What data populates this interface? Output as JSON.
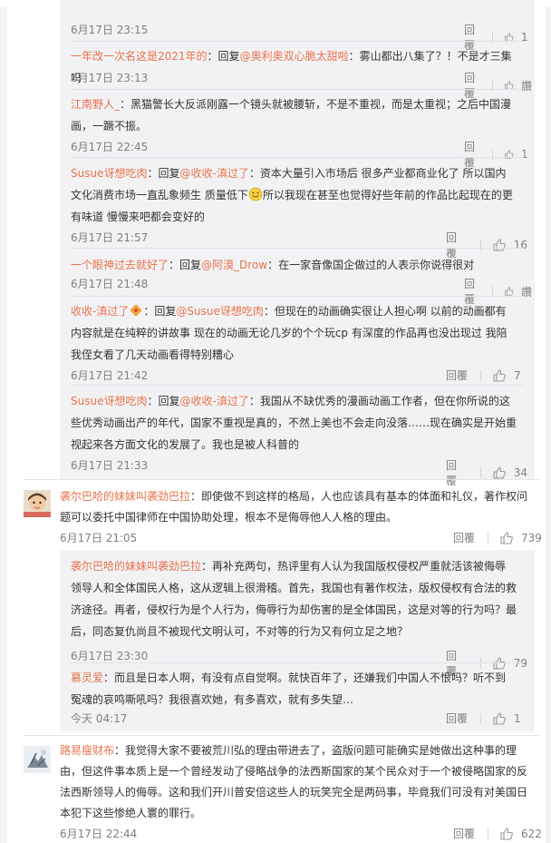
{
  "reply_label": "回覆",
  "replies_top": [
    {
      "time": "6月17日 23:15",
      "likes": "1"
    },
    {
      "user": "一年改一次名这是2021年的",
      "sep": "：回复",
      "mention": "@奥利奥双心脆太甜啦",
      "text": "：雾山都出八集了？！不是才三集吗",
      "time": "6月17日 23:13",
      "likes": "讚"
    },
    {
      "user": "江南野人_",
      "text": "：黑猫警长大反派刚露一个镜头就被腰斩，不是不重视，而是太重视；之后中国漫画，一蹶不振。",
      "time": "6月17日 22:45",
      "likes": "1"
    },
    {
      "user": "Susue讶想吃肉",
      "sep": "：回复",
      "mention": "@收收-滇过了",
      "text_a": "：资本大量引入市场后 很多产业都商业化了 所以国内文化消费市场一直乱象频生 质量低下",
      "text_b": "所以我现在甚至也觉得好些年前的作品比起现在的更有味道 慢慢来吧都会变好的",
      "time": "6月17日 21:57",
      "likes": "16"
    },
    {
      "user": "一个眼神过去就好了",
      "sep": "：回复",
      "mention": "@阿漠_Drow",
      "text": "：在一家音像国企做过的人表示你说得很对",
      "time": "6月17日 21:48",
      "likes": "讚"
    },
    {
      "user": "收收-滇过了",
      "sep": "：回复",
      "mention": "@Susue讶想吃肉",
      "text": "：但现在的动画确实很让人担心啊 以前的动画都有内容就是在纯粹的讲故事 现在的动画无论几岁的个个玩cp 有深度的作品再也没出现过 我陪我侄女看了几天动画看得特别糟心",
      "time": "6月17日 21:42",
      "likes": "7"
    },
    {
      "user": "Susue讶想吃肉",
      "sep": "：回复",
      "mention": "@收收-滇过了",
      "text": "：我国从不缺优秀的漫画动画工作者，但在你所说的这些优秀动画出产的年代，国家不重视是真的，不然上美也不会走向没落……现在确实是开始重视起来各方面文化的发展了。我也是被人科普的",
      "time": "6月17日 21:33",
      "likes": "34"
    }
  ],
  "comment2": {
    "user": "袭尔巴哈的妹妹叫袭劲巴拉",
    "text": "：即使做不到这样的格局，人也应该具有基本的体面和礼仪，著作权问题可以委托中国律师在中国协助处理，根本不是侮辱他人人格的理由。",
    "time": "6月17日 21:05",
    "likes": "739",
    "replies": [
      {
        "user": "袭尔巴哈的妹妹叫袭劲巴拉",
        "text": "：再补充两句，热评里有人认为我国版权侵权严重就活该被侮辱领导人和全体国民人格，这从逻辑上很滑稽。首先，我国也有著作权法，版权侵权有合法的救济途径。再者，侵权行为是个人行为，侮辱行为却伤害的是全体国民，这是对等的行为吗？最后，同态复仇尚且不被现代文明认可，不对等的行为又有何立足之地？",
        "time": "6月17日 23:30",
        "likes": "79"
      },
      {
        "user": "慕灵爱",
        "text": "：而且是日本人啊，有没有点自觉啊。就快百年了，还嫌我们中国人不恨吗？听不到冤魂的哀鸣嘶吼吗？我很喜欢她，有多喜欢，就有多失望…",
        "time": "今天 04:17",
        "likes": "1"
      }
    ]
  },
  "comment3": {
    "user": "路易瘦财布",
    "text": "：我觉得大家不要被荒川弘的理由带进去了，盗版问题可能确实是她做出这种事的理由，但这件事本质上是一个曾经发动了侵略战争的法西斯国家的某个民众对于一个被侵略国家的反法西斯领导人的侮辱。这和我们开川普安倍这些人的玩笑完全是两码事，毕竟我们可没有对美国日本犯下这些惨绝人寰的罪行。",
    "time": "6月17日 22:44",
    "likes": "622"
  },
  "colors": {
    "username": "#e8734b",
    "meta": "#808080",
    "reply_bg": "#f2f2f5"
  },
  "icons": {
    "like": "thumbs-up-icon",
    "search": "search-icon",
    "emoji": "smile-emoji-icon",
    "flower": "flower-emoji-icon"
  }
}
